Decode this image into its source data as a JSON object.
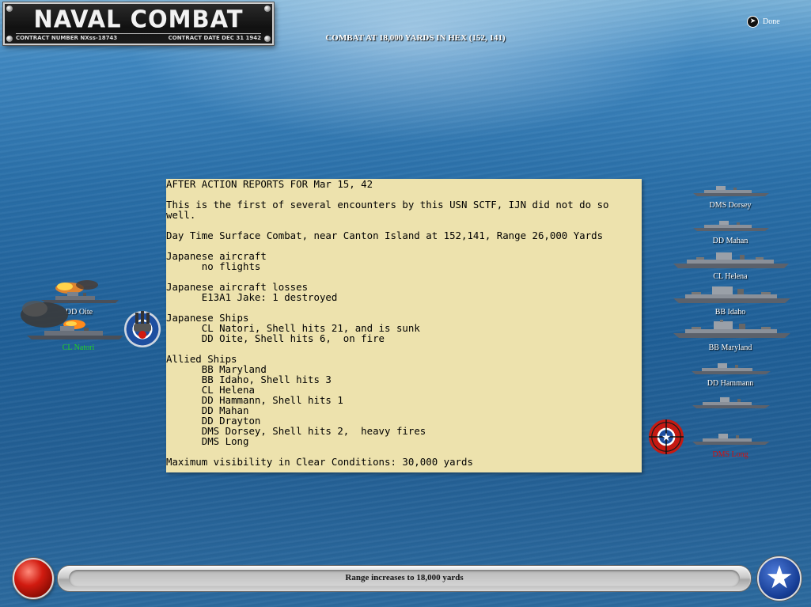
{
  "title": {
    "main": "NAVAL COMBAT",
    "contract_number": "CONTRACT NUMBER  NXss-18743",
    "contract_date": "CONTRACT DATE  DEC 31  1942"
  },
  "header": {
    "combat_text": "COMBAT AT 18,000 YARDS IN HEX (152, 141)"
  },
  "done": {
    "label": "Done",
    "icon": "arrow-right-icon"
  },
  "report": {
    "lines": [
      "AFTER ACTION REPORTS FOR Mar 15, 42",
      "",
      "This is the first of several encounters by this USN SCTF, IJN did not do so",
      "well.",
      "",
      "Day Time Surface Combat, near Canton Island at 152,141, Range 26,000 Yards",
      "",
      "Japanese aircraft",
      "      no flights",
      "",
      "Japanese aircraft losses",
      "      E13A1 Jake: 1 destroyed",
      "",
      "Japanese Ships",
      "      CL Natori, Shell hits 21, and is sunk",
      "      DD Oite, Shell hits 6,  on fire",
      "",
      "Allied Ships",
      "      BB Maryland",
      "      BB Idaho, Shell hits 3",
      "      CL Helena",
      "      DD Hammann, Shell hits 1",
      "      DD Mahan",
      "      DD Drayton",
      "      DMS Dorsey, Shell hits 2,  heavy fires",
      "      DMS Long",
      "",
      "Maximum visibility in Clear Conditions: 30,000 yards"
    ]
  },
  "japanese_ships": [
    {
      "label": "DD Oite",
      "status": "on fire"
    },
    {
      "label": "CL Natori",
      "status": "sinking"
    }
  ],
  "allied_ships": [
    {
      "label": "DMS Dorsey"
    },
    {
      "label": "DD Mahan"
    },
    {
      "label": "CL Helena"
    },
    {
      "label": "BB Idaho"
    },
    {
      "label": "BB Maryland"
    },
    {
      "label": "DD Hammann"
    },
    {
      "label": "DD Drayton"
    },
    {
      "label": "DMS Long",
      "status": "targeted"
    }
  ],
  "status_bar": {
    "message": "Range increases to 18,000 yards"
  },
  "colors": {
    "report_bg": "#ede2ad",
    "targeted_label": "#d01010",
    "sunk_label": "#22d022",
    "ocean": "#1f5f97"
  }
}
